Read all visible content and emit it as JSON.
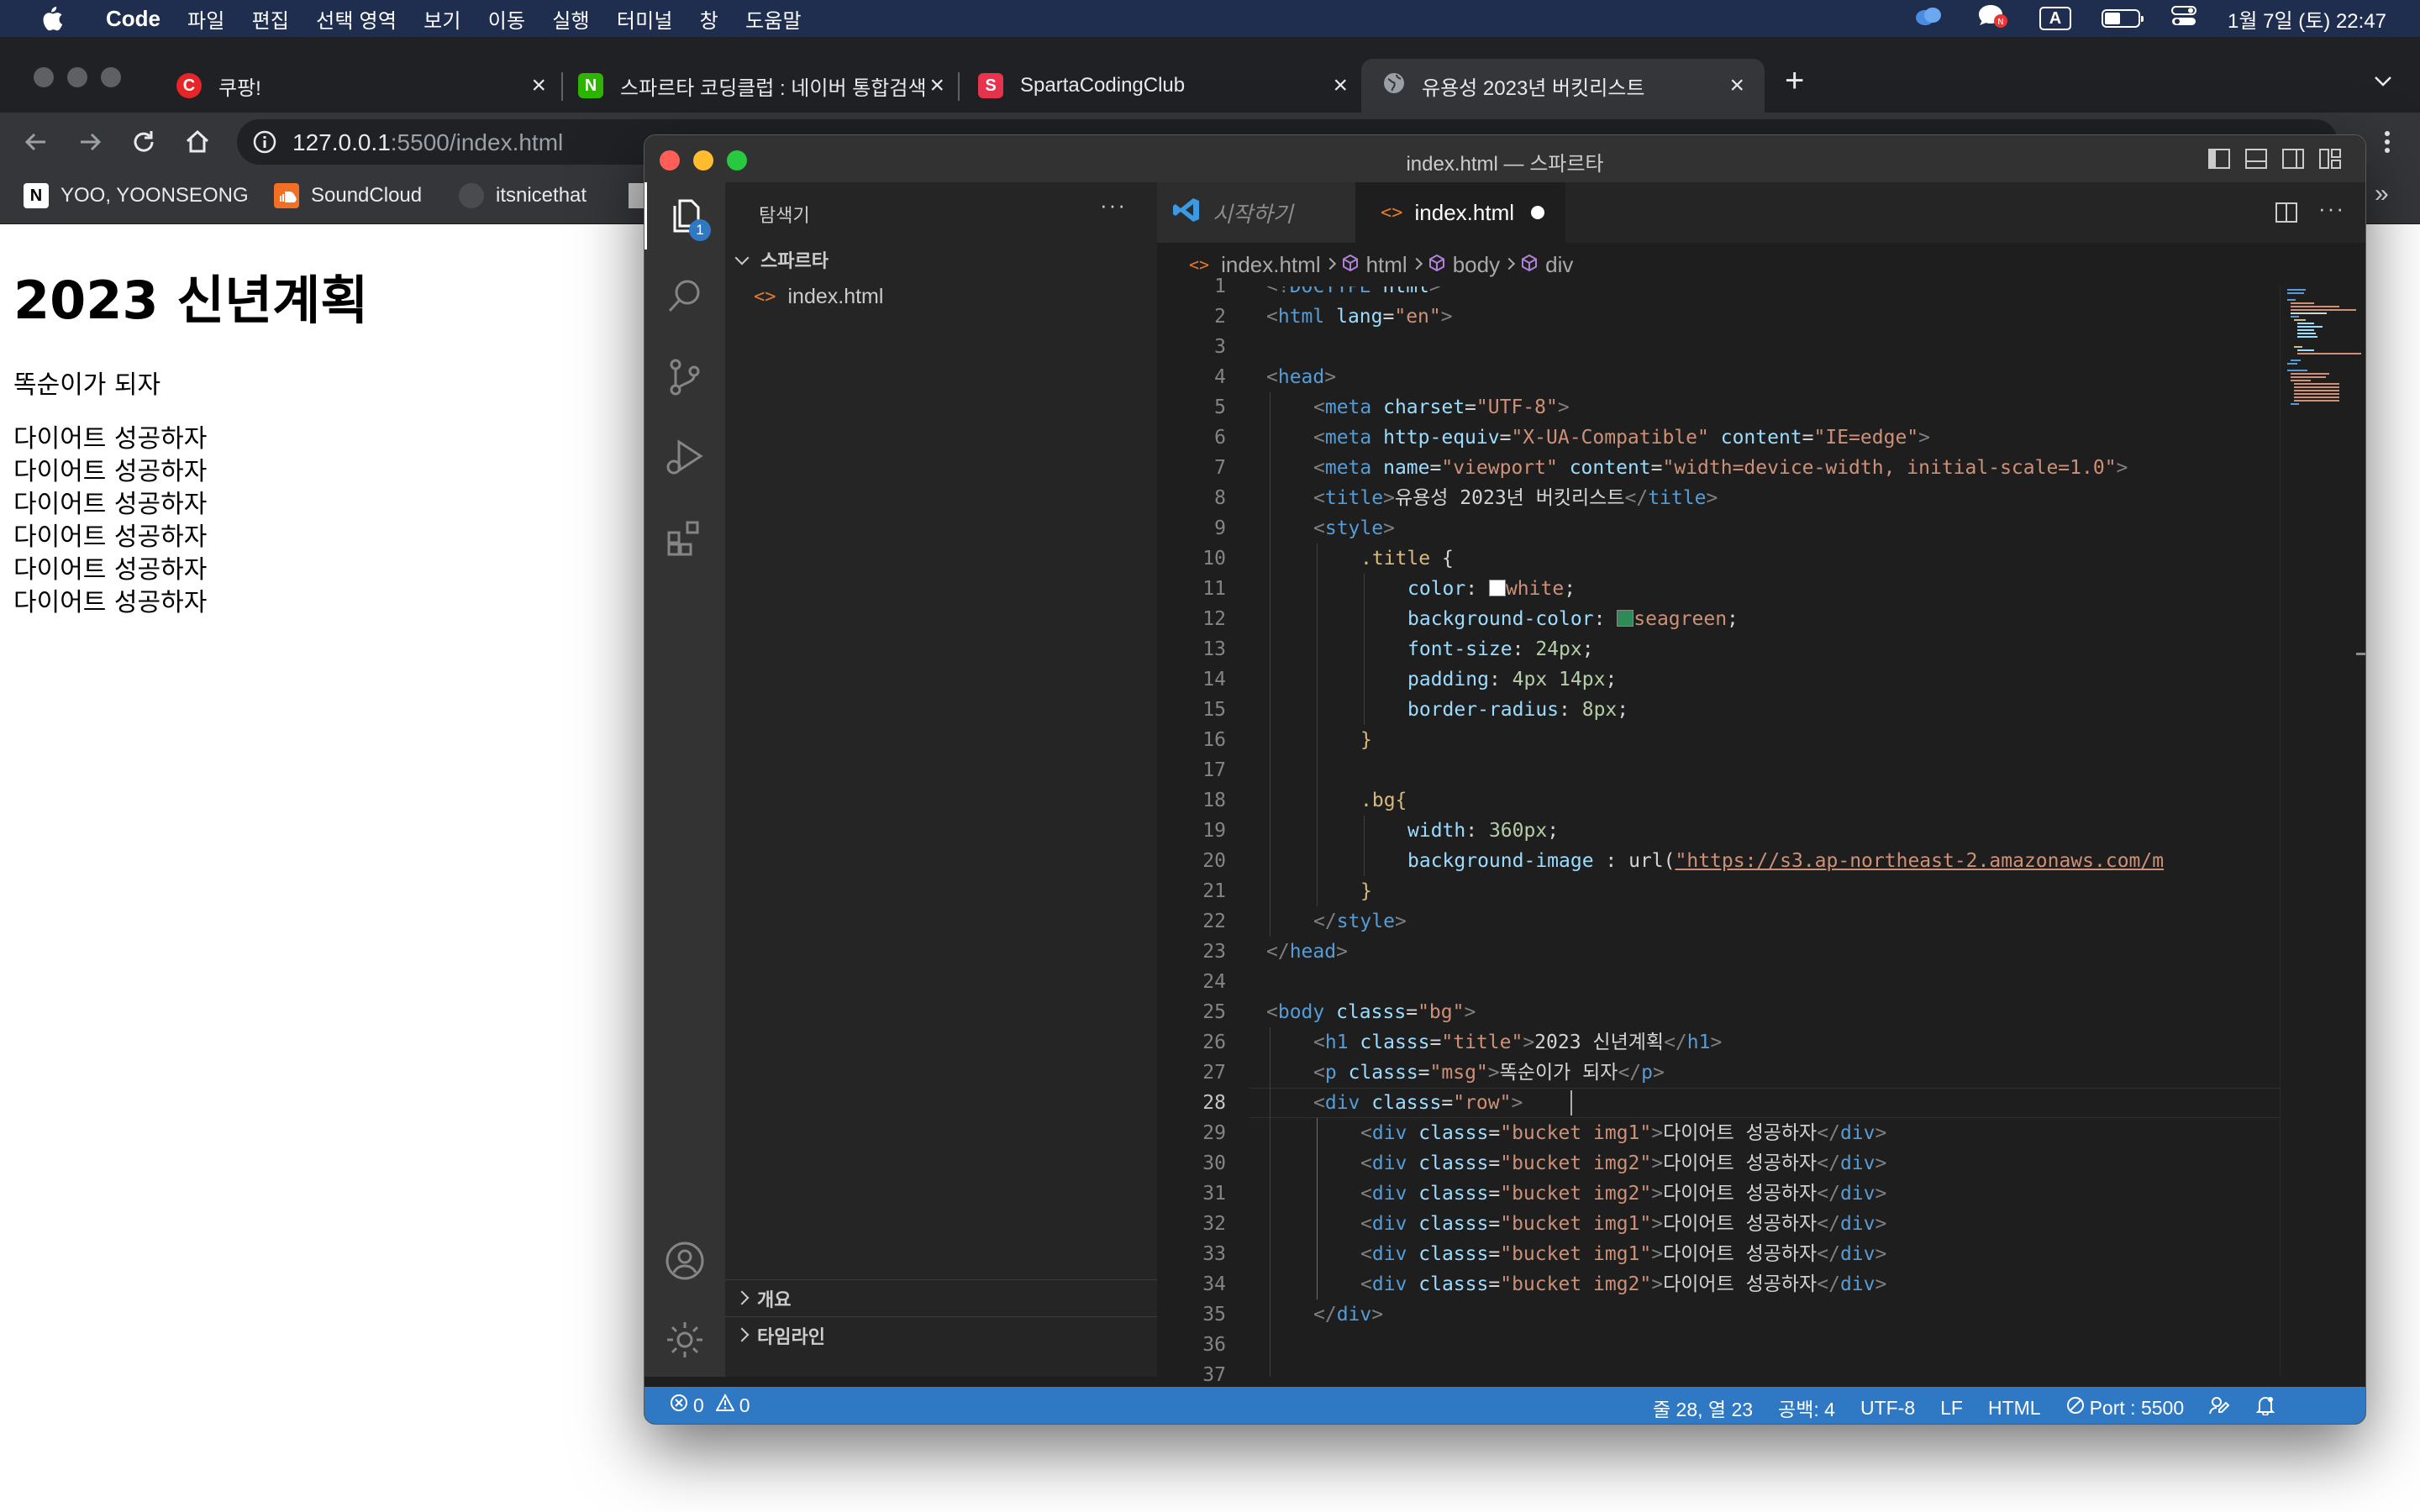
{
  "menubar": {
    "app_name": "Code",
    "items": [
      "파일",
      "편집",
      "선택 영역",
      "보기",
      "이동",
      "실행",
      "터미널",
      "창",
      "도움말"
    ],
    "input_indicator": "A",
    "clock": "1월 7일 (토) 22:47"
  },
  "browser": {
    "tabs": [
      {
        "title": "쿠팡!",
        "icon_letter": "C",
        "icon_color": "#e52528"
      },
      {
        "title": "스파르타 코딩클럽 : 네이버 통합검색",
        "icon_letter": "N",
        "icon_color": "#2db400"
      },
      {
        "title": "SpartaCodingClub",
        "icon_letter": "S",
        "icon_color": "#e8344e"
      },
      {
        "title": "유용성 2023년 버킷리스트",
        "icon_letter": "",
        "icon_color": "#9aa0a6"
      }
    ],
    "url_host": "127.0.0.1",
    "url_rest": ":5500/index.html",
    "bookmarks": [
      {
        "label": "YOO, YOONSEONG",
        "icon": "notion-icon"
      },
      {
        "label": "SoundCloud",
        "icon": "soundcloud-icon"
      },
      {
        "label": "itsnicethat",
        "icon": "itsnicethat-icon"
      }
    ]
  },
  "page": {
    "title": "2023 신년계획",
    "msg": "똑순이가 되자",
    "buckets": [
      "다이어트 성공하자",
      "다이어트 성공하자",
      "다이어트 성공하자",
      "다이어트 성공하자",
      "다이어트 성공하자",
      "다이어트 성공하자"
    ]
  },
  "vscode": {
    "window_title": "index.html — 스파르타",
    "activity_badge": "1",
    "sidebar": {
      "header": "탐색기",
      "folder": "스파르타",
      "file": "index.html",
      "outline": "개요",
      "timeline": "타임라인"
    },
    "tabs": [
      {
        "label": "시작하기"
      },
      {
        "label": "index.html"
      }
    ],
    "breadcrumbs": [
      "index.html",
      "html",
      "body",
      "div"
    ],
    "status": {
      "errors": "0",
      "warnings": "0",
      "position": "줄 28, 열 23",
      "spaces": "공백: 4",
      "encoding": "UTF-8",
      "eol": "LF",
      "language": "HTML",
      "port": "Port : 5500"
    },
    "code_lines": [
      {
        "n": "1",
        "indent": 0,
        "html": "<span class='t-br'>&lt;!</span><span class='t-tag'>DOCTYPE</span> <span class='t-attr'>html</span><span class='t-br'>&gt;</span>"
      },
      {
        "n": "2",
        "indent": 0,
        "html": "<span class='t-br'>&lt;</span><span class='t-tag'>html</span> <span class='t-attr'>lang</span>=<span class='t-str'>\"en\"</span><span class='t-br'>&gt;</span>"
      },
      {
        "n": "3",
        "indent": 0,
        "html": ""
      },
      {
        "n": "4",
        "indent": 0,
        "html": "<span class='t-br'>&lt;</span><span class='t-tag'>head</span><span class='t-br'>&gt;</span>"
      },
      {
        "n": "5",
        "indent": 1,
        "html": "<span class='t-br'>&lt;</span><span class='t-tag'>meta</span> <span class='t-attr'>charset</span>=<span class='t-str'>\"UTF-8\"</span><span class='t-br'>&gt;</span>"
      },
      {
        "n": "6",
        "indent": 1,
        "html": "<span class='t-br'>&lt;</span><span class='t-tag'>meta</span> <span class='t-attr'>http-equiv</span>=<span class='t-str'>\"X-UA-Compatible\"</span> <span class='t-attr'>content</span>=<span class='t-str'>\"IE=edge\"</span><span class='t-br'>&gt;</span>"
      },
      {
        "n": "7",
        "indent": 1,
        "html": "<span class='t-br'>&lt;</span><span class='t-tag'>meta</span> <span class='t-attr'>name</span>=<span class='t-str'>\"viewport\"</span> <span class='t-attr'>content</span>=<span class='t-str'>\"width=device-width, initial-scale=1.0\"</span><span class='t-br'>&gt;</span>"
      },
      {
        "n": "8",
        "indent": 1,
        "html": "<span class='t-br'>&lt;</span><span class='t-tag'>title</span><span class='t-br'>&gt;</span><span class='t-txt'>유용성 2023년 버킷리스트</span><span class='t-br'>&lt;/</span><span class='t-tag'>title</span><span class='t-br'>&gt;</span>"
      },
      {
        "n": "9",
        "indent": 1,
        "html": "<span class='t-br'>&lt;</span><span class='t-tag'>style</span><span class='t-br'>&gt;</span>"
      },
      {
        "n": "10",
        "indent": 2,
        "html": "<span class='t-sel'>.title</span> <span class='t-txt'>{</span>"
      },
      {
        "n": "11",
        "indent": 3,
        "html": "<span class='t-prop'>color</span>: <span style='display:inline-block;width:18px;height:18px;background:#ffffff;border:1px solid #888;vertical-align:-2px'></span><span class='t-str'>white</span>;"
      },
      {
        "n": "12",
        "indent": 3,
        "html": "<span class='t-prop'>background-color</span>: <span style='display:inline-block;width:18px;height:18px;background:#2e8b57;border:1px solid #888;vertical-align:-2px'></span><span class='t-str'>seagreen</span>;"
      },
      {
        "n": "13",
        "indent": 3,
        "html": "<span class='t-prop'>font-size</span>: <span class='t-num'>24px</span>;"
      },
      {
        "n": "14",
        "indent": 3,
        "html": "<span class='t-prop'>padding</span>: <span class='t-num'>4px</span> <span class='t-num'>14px</span>;"
      },
      {
        "n": "15",
        "indent": 3,
        "html": "<span class='t-prop'>border-radius</span>: <span class='t-num'>8px</span>;"
      },
      {
        "n": "16",
        "indent": 2,
        "html": "<span class='t-sel'>}</span>"
      },
      {
        "n": "17",
        "indent": 0,
        "html": ""
      },
      {
        "n": "18",
        "indent": 2,
        "html": "<span class='t-sel'>.bg{</span>"
      },
      {
        "n": "19",
        "indent": 3,
        "html": "<span class='t-prop'>width</span>: <span class='t-num'>360px</span>;"
      },
      {
        "n": "20",
        "indent": 3,
        "html": "<span class='t-prop'>background-image</span> : <span class='t-txt'>url(</span><span class='t-url'>\"https://s3.ap-northeast-2.amazonaws.com/m</span>"
      },
      {
        "n": "21",
        "indent": 2,
        "html": "<span class='t-sel'>}</span>"
      },
      {
        "n": "22",
        "indent": 1,
        "html": "<span class='t-br'>&lt;/</span><span class='t-tag'>style</span><span class='t-br'>&gt;</span>"
      },
      {
        "n": "23",
        "indent": 0,
        "html": "<span class='t-br'>&lt;/</span><span class='t-tag'>head</span><span class='t-br'>&gt;</span>"
      },
      {
        "n": "24",
        "indent": 0,
        "html": ""
      },
      {
        "n": "25",
        "indent": 0,
        "html": "<span class='t-br'>&lt;</span><span class='t-tag'>body</span> <span class='t-attr'>classs</span>=<span class='t-str'>\"bg\"</span><span class='t-br'>&gt;</span>"
      },
      {
        "n": "26",
        "indent": 1,
        "html": "<span class='t-br'>&lt;</span><span class='t-tag'>h1</span> <span class='t-attr'>classs</span>=<span class='t-str'>\"title\"</span><span class='t-br'>&gt;</span><span class='t-txt'>2023 신년계획</span><span class='t-br'>&lt;/</span><span class='t-tag'>h1</span><span class='t-br'>&gt;</span>"
      },
      {
        "n": "27",
        "indent": 1,
        "html": "<span class='t-br'>&lt;</span><span class='t-tag'>p</span> <span class='t-attr'>classs</span>=<span class='t-str'>\"msg\"</span><span class='t-br'>&gt;</span><span class='t-txt'>똑순이가 되자</span><span class='t-br'>&lt;/</span><span class='t-tag'>p</span><span class='t-br'>&gt;</span>"
      },
      {
        "n": "28",
        "indent": 1,
        "html": "<span class='t-br'>&lt;</span><span class='t-tag'>div</span> <span class='t-attr'>classs</span>=<span class='t-str'>\"row\"</span><span class='t-br'>&gt;</span>"
      },
      {
        "n": "29",
        "indent": 2,
        "html": "<span class='t-br'>&lt;</span><span class='t-tag'>div</span> <span class='t-attr'>classs</span>=<span class='t-str'>\"bucket img1\"</span><span class='t-br'>&gt;</span><span class='t-txt'>다이어트 성공하자</span><span class='t-br'>&lt;/</span><span class='t-tag'>div</span><span class='t-br'>&gt;</span>"
      },
      {
        "n": "30",
        "indent": 2,
        "html": "<span class='t-br'>&lt;</span><span class='t-tag'>div</span> <span class='t-attr'>classs</span>=<span class='t-str'>\"bucket img2\"</span><span class='t-br'>&gt;</span><span class='t-txt'>다이어트 성공하자</span><span class='t-br'>&lt;/</span><span class='t-tag'>div</span><span class='t-br'>&gt;</span>"
      },
      {
        "n": "31",
        "indent": 2,
        "html": "<span class='t-br'>&lt;</span><span class='t-tag'>div</span> <span class='t-attr'>classs</span>=<span class='t-str'>\"bucket img2\"</span><span class='t-br'>&gt;</span><span class='t-txt'>다이어트 성공하자</span><span class='t-br'>&lt;/</span><span class='t-tag'>div</span><span class='t-br'>&gt;</span>"
      },
      {
        "n": "32",
        "indent": 2,
        "html": "<span class='t-br'>&lt;</span><span class='t-tag'>div</span> <span class='t-attr'>classs</span>=<span class='t-str'>\"bucket img1\"</span><span class='t-br'>&gt;</span><span class='t-txt'>다이어트 성공하자</span><span class='t-br'>&lt;/</span><span class='t-tag'>div</span><span class='t-br'>&gt;</span>"
      },
      {
        "n": "33",
        "indent": 2,
        "html": "<span class='t-br'>&lt;</span><span class='t-tag'>div</span> <span class='t-attr'>classs</span>=<span class='t-str'>\"bucket img1\"</span><span class='t-br'>&gt;</span><span class='t-txt'>다이어트 성공하자</span><span class='t-br'>&lt;/</span><span class='t-tag'>div</span><span class='t-br'>&gt;</span>"
      },
      {
        "n": "34",
        "indent": 2,
        "html": "<span class='t-br'>&lt;</span><span class='t-tag'>div</span> <span class='t-attr'>classs</span>=<span class='t-str'>\"bucket img2\"</span><span class='t-br'>&gt;</span><span class='t-txt'>다이어트 성공하자</span><span class='t-br'>&lt;/</span><span class='t-tag'>div</span><span class='t-br'>&gt;</span>"
      },
      {
        "n": "35",
        "indent": 1,
        "html": "<span class='t-br'>&lt;/</span><span class='t-tag'>div</span><span class='t-br'>&gt;</span>"
      },
      {
        "n": "36",
        "indent": 0,
        "html": ""
      },
      {
        "n": "37",
        "indent": 0,
        "html": ""
      }
    ]
  }
}
